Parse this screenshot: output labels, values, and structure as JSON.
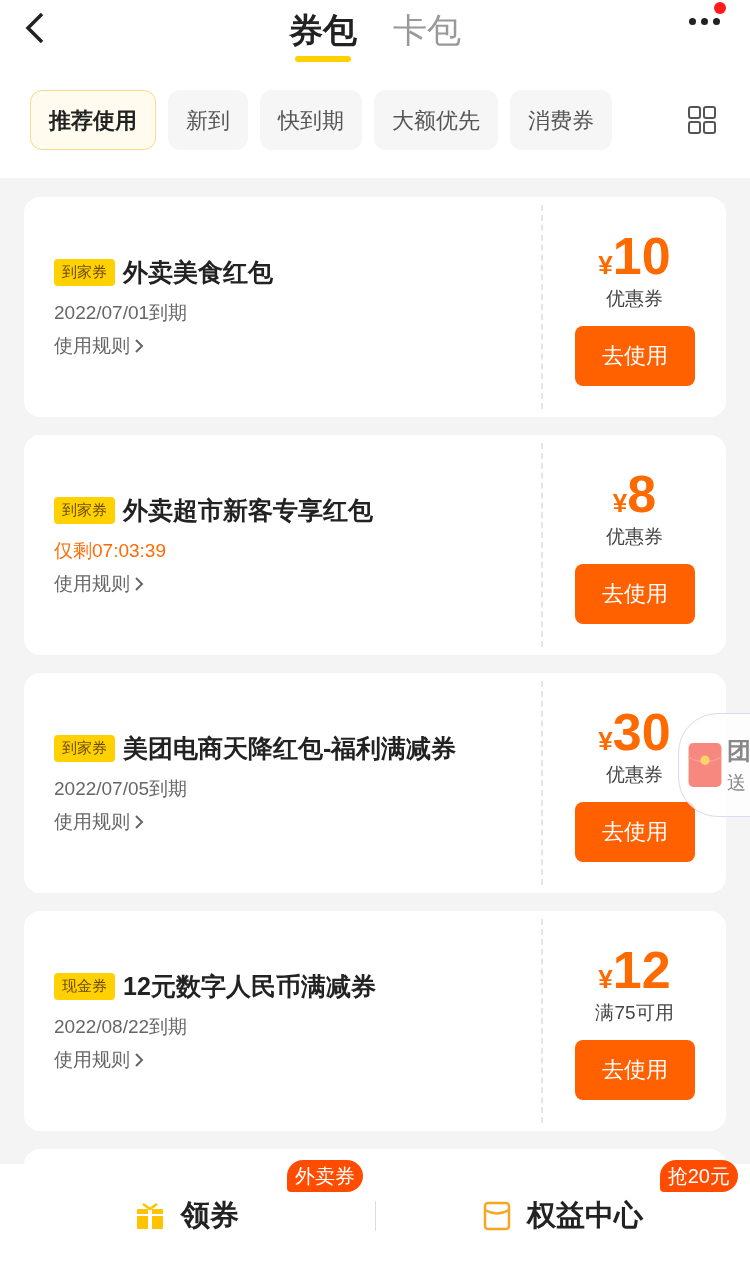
{
  "header": {
    "tabs": [
      {
        "label": "券包",
        "selected": true
      },
      {
        "label": "卡包",
        "selected": false
      }
    ],
    "has_notification": true
  },
  "filters": [
    {
      "label": "推荐使用",
      "selected": true
    },
    {
      "label": "新到",
      "selected": false
    },
    {
      "label": "快到期",
      "selected": false
    },
    {
      "label": "大额优先",
      "selected": false
    },
    {
      "label": "消费券",
      "selected": false
    }
  ],
  "coupons": [
    {
      "tag": "到家券",
      "title": "外卖美食红包",
      "expiry": "2022/07/01到期",
      "urgent": false,
      "rules": "使用规则",
      "currency": "¥",
      "amount": "10",
      "condition": "优惠券",
      "button": "去使用"
    },
    {
      "tag": "到家券",
      "title": "外卖超市新客专享红包",
      "expiry": "仅剩07:03:39",
      "urgent": true,
      "rules": "使用规则",
      "currency": "¥",
      "amount": "8",
      "condition": "优惠券",
      "button": "去使用"
    },
    {
      "tag": "到家券",
      "title": "美团电商天降红包-福利满减券",
      "expiry": "2022/07/05到期",
      "urgent": false,
      "rules": "使用规则",
      "currency": "¥",
      "amount": "30",
      "condition": "优惠券",
      "button": "去使用"
    },
    {
      "tag": "现金券",
      "title": "12元数字人民币满减券",
      "expiry": "2022/08/22到期",
      "urgent": false,
      "rules": "使用规则",
      "currency": "¥",
      "amount": "12",
      "condition": "满75可用",
      "button": "去使用"
    }
  ],
  "floating_widget": {
    "title": "团",
    "subtitle": "送"
  },
  "bottom_bar": [
    {
      "kind": "gift",
      "label": "领券",
      "badge": "外卖券"
    },
    {
      "kind": "wallet",
      "label": "权益中心",
      "badge": "抢20元"
    }
  ]
}
